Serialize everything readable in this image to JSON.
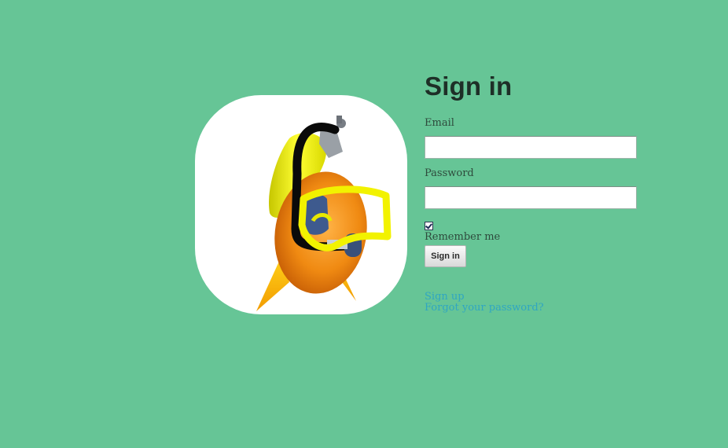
{
  "mascot": {
    "icon": "scuba-fish-mascot-icon"
  },
  "form": {
    "title": "Sign in",
    "email_label": "Email",
    "email_value": "",
    "password_label": "Password",
    "password_value": "",
    "remember_label": "Remember me",
    "remember_checked": true,
    "submit_label": "Sign in"
  },
  "links": {
    "sign_up": "Sign up",
    "forgot_password": "Forgot your password?"
  },
  "colors": {
    "background": "#66c596",
    "link": "#2fa6c2",
    "title": "#1e2f27"
  }
}
